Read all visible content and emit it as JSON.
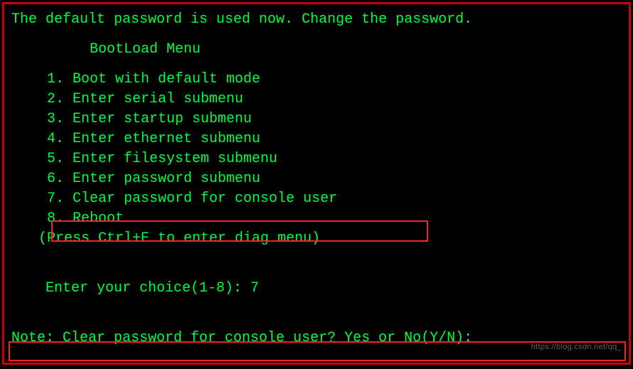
{
  "warning": "The default password is used now. Change the password.",
  "menu_title": "          BootLoad Menu",
  "items": [
    "     1. Boot with default mode",
    "     2. Enter serial submenu",
    "     3. Enter startup submenu",
    "     4. Enter ethernet submenu",
    "     5. Enter filesystem submenu",
    "     6. Enter password submenu",
    "     7. Clear password for console user",
    "     8. Reboot"
  ],
  "hint": "    (Press Ctrl+E to enter diag menu)",
  "prompt": "Enter your choice(1-8): ",
  "choice_value": "7",
  "confirm": "Note: Clear password for console user? Yes or No(Y/N):",
  "watermark": "https://blog.csdn.net/qq_"
}
